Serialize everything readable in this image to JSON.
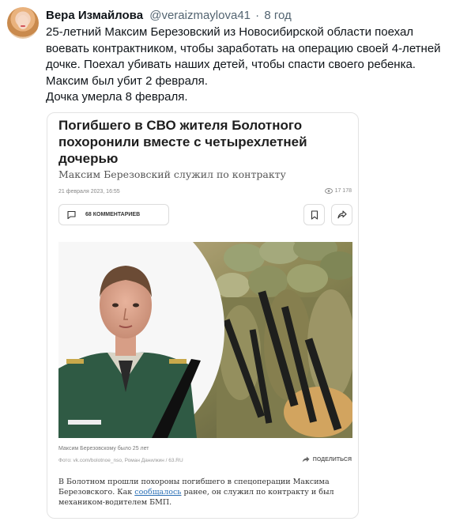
{
  "tweet": {
    "author_name": "Вера Измайлова",
    "author_handle": "@veraizmaylova41",
    "separator": "·",
    "timestamp": "8 год",
    "lines": [
      "25-летний Максим Березовский из Новосибирской области поехал воевать контрактником, чтобы заработать на операцию своей 4-летней дочке. Поехал убивать наших детей, чтобы спасти своего ребенка.",
      "Максим был убит 2 февраля.",
      "Дочка умерла 8 февраля."
    ]
  },
  "article": {
    "headline": "Погибшего в СВО жителя Болотного похоронили вместе с четырехлетней дочерью",
    "subtitle": "Максим Березовский служил по контракту",
    "date": "21 февраля 2023, 16:55",
    "views": "17 178",
    "comments_label": "68 КОММЕНТАРИЕВ",
    "photo_caption": "Максим Березовскому было 25 лет",
    "photo_source": "Фото: vk.com/bolotnoe_nso, Роман Данилкин / 63.RU",
    "share_label": "ПОДЕЛИТЬСЯ",
    "body_start": "В Болотном прошли похороны погибшего в спецоперации Максима Березовского. Как ",
    "body_link": "сообщалось",
    "body_end": " ранее, он служил по контракту и был механиком-водителем БМП."
  },
  "icons": [
    "comment-icon",
    "bookmark-icon",
    "share-icon",
    "eye-icon",
    "share-arrow-icon"
  ],
  "colors": {
    "handle": "#536471",
    "link": "#2a6fb5",
    "headline": "#1e1e1e"
  }
}
